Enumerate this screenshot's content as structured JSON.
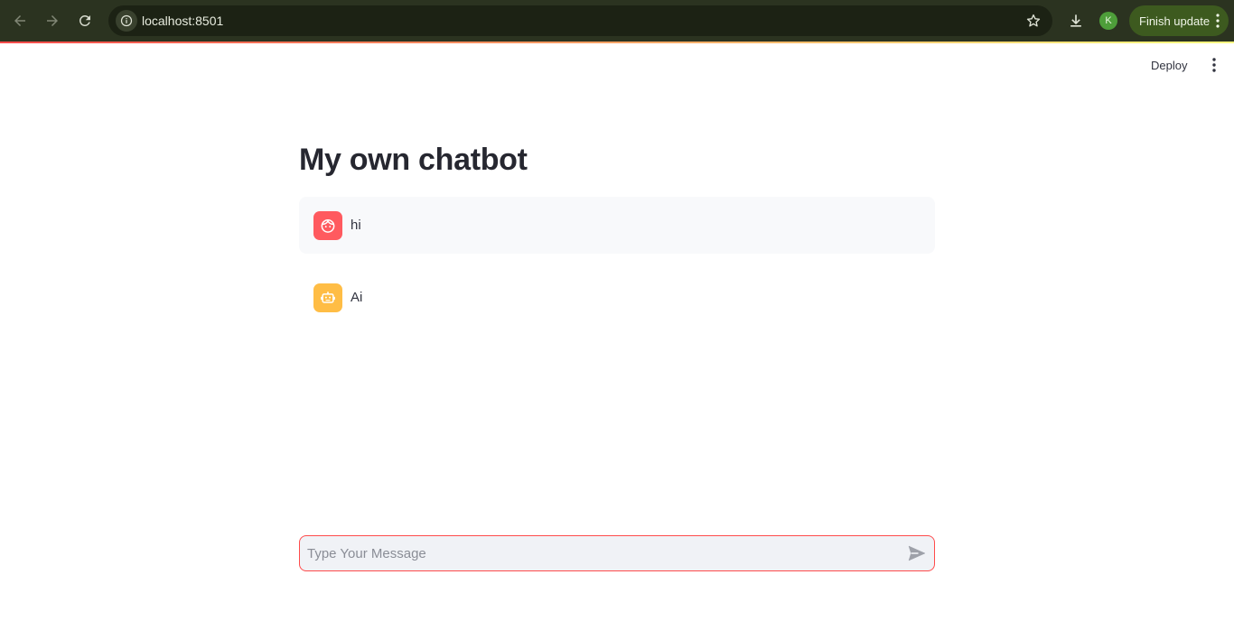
{
  "browser": {
    "url": "localhost:8501",
    "profile_initial": "K",
    "finish_update_label": "Finish update"
  },
  "app_header": {
    "deploy_label": "Deploy"
  },
  "main": {
    "title": "My own chatbot",
    "messages": [
      {
        "role": "user",
        "avatar_icon": "user-face-icon",
        "text": "hi"
      },
      {
        "role": "assistant",
        "avatar_icon": "robot-icon",
        "text": "Ai"
      }
    ]
  },
  "chat_input": {
    "placeholder": "Type Your Message",
    "value": ""
  },
  "colors": {
    "browser_bar": "#2b3320",
    "accent_red": "#ff4b4b",
    "user_avatar": "#ff5a5f",
    "assistant_avatar": "#ffbd45",
    "finish_update_bg": "#3d5a1f"
  }
}
